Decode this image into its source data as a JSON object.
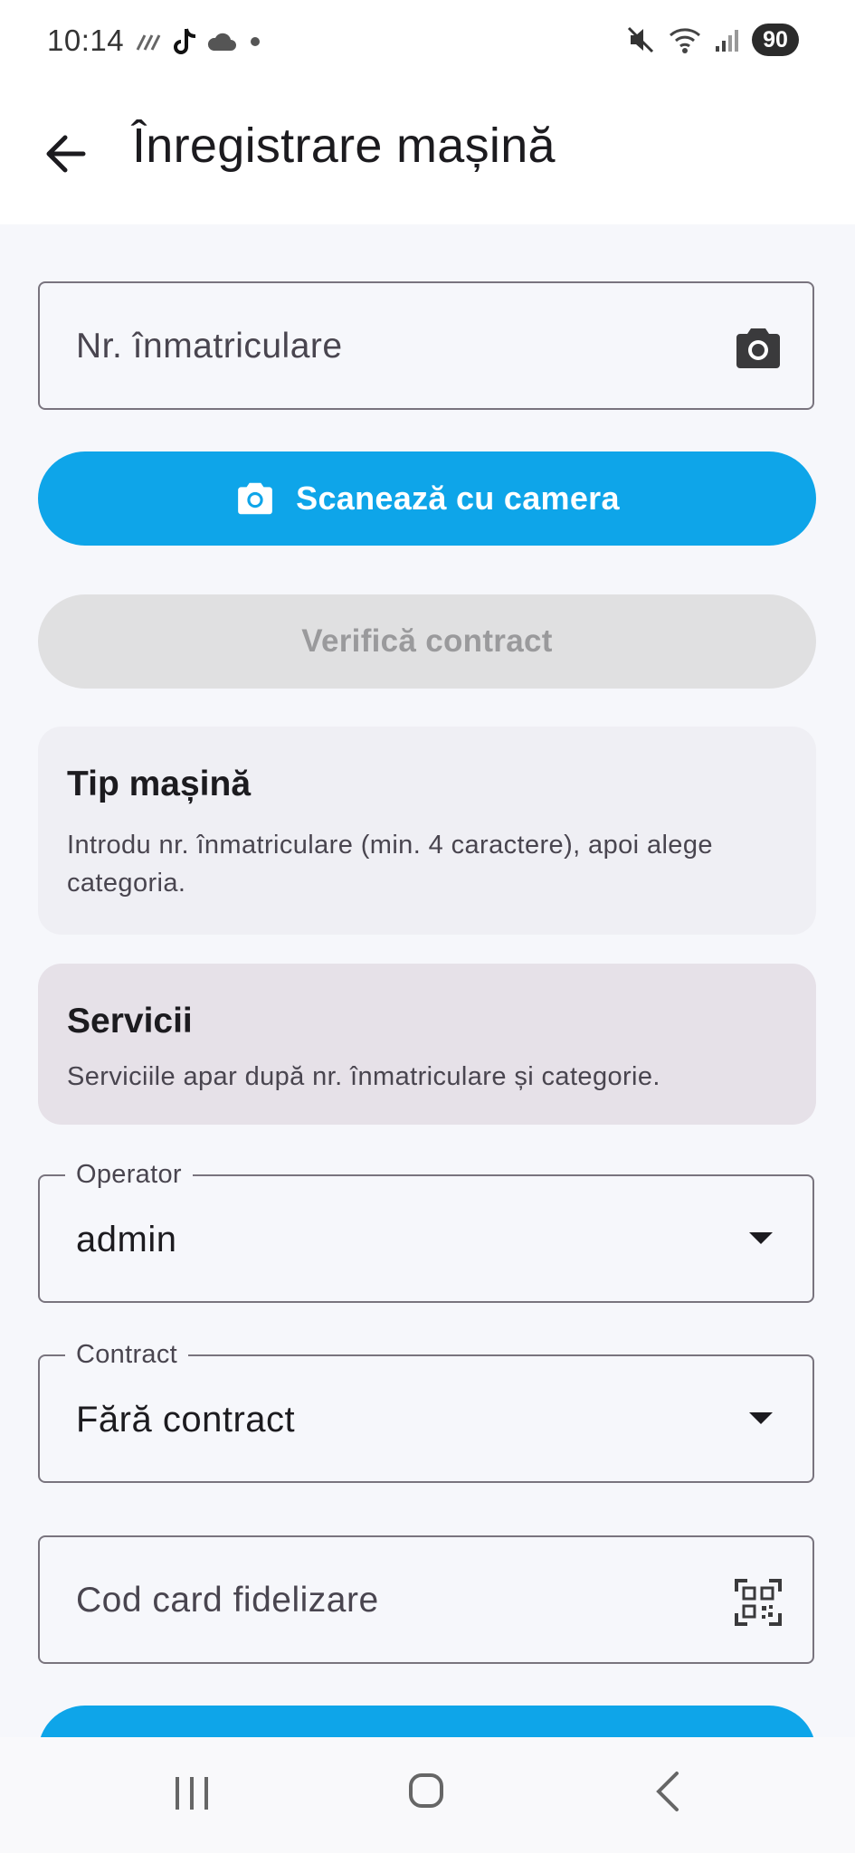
{
  "status_bar": {
    "time": "10:14",
    "battery": "90"
  },
  "app_bar": {
    "title": "Înregistrare mașină"
  },
  "plate_field": {
    "placeholder": "Nr. înmatriculare"
  },
  "scan_button": {
    "label": "Scanează cu camera"
  },
  "verify_button": {
    "label": "Verifică contract"
  },
  "car_type_card": {
    "title": "Tip mașină",
    "description": "Introdu nr. înmatriculare (min. 4 caractere), apoi alege categoria."
  },
  "services_card": {
    "title": "Servicii",
    "description": "Serviciile apar după nr. înmatriculare și categorie."
  },
  "operator_field": {
    "label": "Operator",
    "value": "admin"
  },
  "contract_field": {
    "label": "Contract",
    "value": "Fără contract"
  },
  "loyalty_field": {
    "placeholder": "Cod card fidelizare"
  },
  "colors": {
    "primary": "#0ea5e9",
    "disabled_bg": "#e0e0e1",
    "card_bg": "#efeff4",
    "services_bg": "#e6e1e8"
  },
  "icons": [
    "back-arrow-icon",
    "camera-icon",
    "qr-code-icon",
    "dropdown-arrow-icon"
  ]
}
